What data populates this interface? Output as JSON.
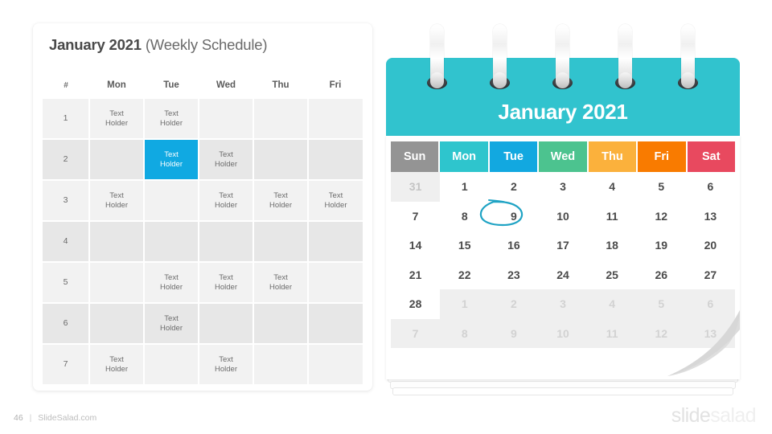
{
  "schedule": {
    "title_bold": "January 2021",
    "title_light": "(Weekly Schedule)",
    "columns": [
      "#",
      "Mon",
      "Tue",
      "Wed",
      "Thu",
      "Fri"
    ],
    "cell_text": "Text\nHolder",
    "highlight_color": "#10a9e2",
    "rows": [
      {
        "index": "1",
        "cells": [
          "Text Holder",
          "Text Holder",
          "",
          "",
          ""
        ],
        "highlight": -1
      },
      {
        "index": "2",
        "cells": [
          "",
          "Text Holder",
          "Text Holder",
          "",
          ""
        ],
        "highlight": 1
      },
      {
        "index": "3",
        "cells": [
          "Text Holder",
          "",
          "Text Holder",
          "Text Holder",
          "Text Holder"
        ],
        "highlight": -1
      },
      {
        "index": "4",
        "cells": [
          "",
          "",
          "",
          "",
          ""
        ],
        "highlight": -1
      },
      {
        "index": "5",
        "cells": [
          "",
          "Text Holder",
          "Text Holder",
          "Text Holder",
          ""
        ],
        "highlight": -1
      },
      {
        "index": "6",
        "cells": [
          "",
          "Text Holder",
          "",
          "",
          ""
        ],
        "highlight": -1
      },
      {
        "index": "7",
        "cells": [
          "Text Holder",
          "",
          "Text Holder",
          "",
          ""
        ],
        "highlight": -1
      }
    ]
  },
  "calendar": {
    "month_title": "January 2021",
    "header_color": "#31c3ce",
    "ring_count": 5,
    "day_headers": [
      {
        "label": "Sun",
        "color": "#949494"
      },
      {
        "label": "Mon",
        "color": "#2ec5cd"
      },
      {
        "label": "Tue",
        "color": "#12a8e0"
      },
      {
        "label": "Wed",
        "color": "#4cc38f"
      },
      {
        "label": "Thu",
        "color": "#fbb13c"
      },
      {
        "label": "Fri",
        "color": "#f97b00"
      },
      {
        "label": "Sat",
        "color": "#e8495f"
      }
    ],
    "marked_day": "9",
    "mark_color": "#1fa3c4",
    "weeks": [
      [
        {
          "d": "31",
          "t": "prev"
        },
        {
          "d": "1",
          "t": "cur"
        },
        {
          "d": "2",
          "t": "cur"
        },
        {
          "d": "3",
          "t": "cur"
        },
        {
          "d": "4",
          "t": "cur"
        },
        {
          "d": "5",
          "t": "cur"
        },
        {
          "d": "6",
          "t": "cur"
        }
      ],
      [
        {
          "d": "7",
          "t": "cur"
        },
        {
          "d": "8",
          "t": "cur"
        },
        {
          "d": "9",
          "t": "cur",
          "marked": true
        },
        {
          "d": "10",
          "t": "cur"
        },
        {
          "d": "11",
          "t": "cur"
        },
        {
          "d": "12",
          "t": "cur"
        },
        {
          "d": "13",
          "t": "cur"
        }
      ],
      [
        {
          "d": "14",
          "t": "cur"
        },
        {
          "d": "15",
          "t": "cur"
        },
        {
          "d": "16",
          "t": "cur"
        },
        {
          "d": "17",
          "t": "cur"
        },
        {
          "d": "18",
          "t": "cur"
        },
        {
          "d": "19",
          "t": "cur"
        },
        {
          "d": "20",
          "t": "cur"
        }
      ],
      [
        {
          "d": "21",
          "t": "cur"
        },
        {
          "d": "22",
          "t": "cur"
        },
        {
          "d": "23",
          "t": "cur"
        },
        {
          "d": "24",
          "t": "cur"
        },
        {
          "d": "25",
          "t": "cur"
        },
        {
          "d": "26",
          "t": "cur"
        },
        {
          "d": "27",
          "t": "cur"
        }
      ],
      [
        {
          "d": "28",
          "t": "curwhite"
        },
        {
          "d": "1",
          "t": "next"
        },
        {
          "d": "2",
          "t": "next"
        },
        {
          "d": "3",
          "t": "next"
        },
        {
          "d": "4",
          "t": "next"
        },
        {
          "d": "5",
          "t": "next"
        },
        {
          "d": "6",
          "t": "next"
        }
      ],
      [
        {
          "d": "7",
          "t": "next"
        },
        {
          "d": "8",
          "t": "next"
        },
        {
          "d": "9",
          "t": "next"
        },
        {
          "d": "10",
          "t": "next"
        },
        {
          "d": "11",
          "t": "next"
        },
        {
          "d": "12",
          "t": "next"
        },
        {
          "d": "13",
          "t": "next"
        }
      ]
    ]
  },
  "footer": {
    "page_number": "46",
    "separator": "|",
    "site": "SlideSalad.com",
    "logo_first": "slide",
    "logo_second": "salad"
  }
}
